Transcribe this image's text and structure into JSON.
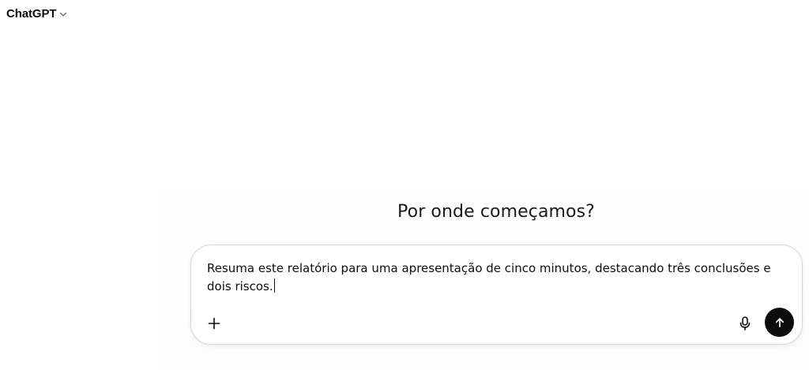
{
  "header": {
    "model_name": "ChatGPT",
    "chevron_icon": "chevron-down-icon"
  },
  "main": {
    "greeting": "Por onde começamos?"
  },
  "composer": {
    "prompt_text": "Resuma este relatório para uma apresentação de cinco minutos, destacando três conclusões e dois riscos.",
    "attach_icon": "plus-icon",
    "mic_icon": "microphone-icon",
    "send_icon": "arrow-up-icon",
    "send_button_color": "#0d0d0d",
    "border_color": "#d9d9d9"
  }
}
